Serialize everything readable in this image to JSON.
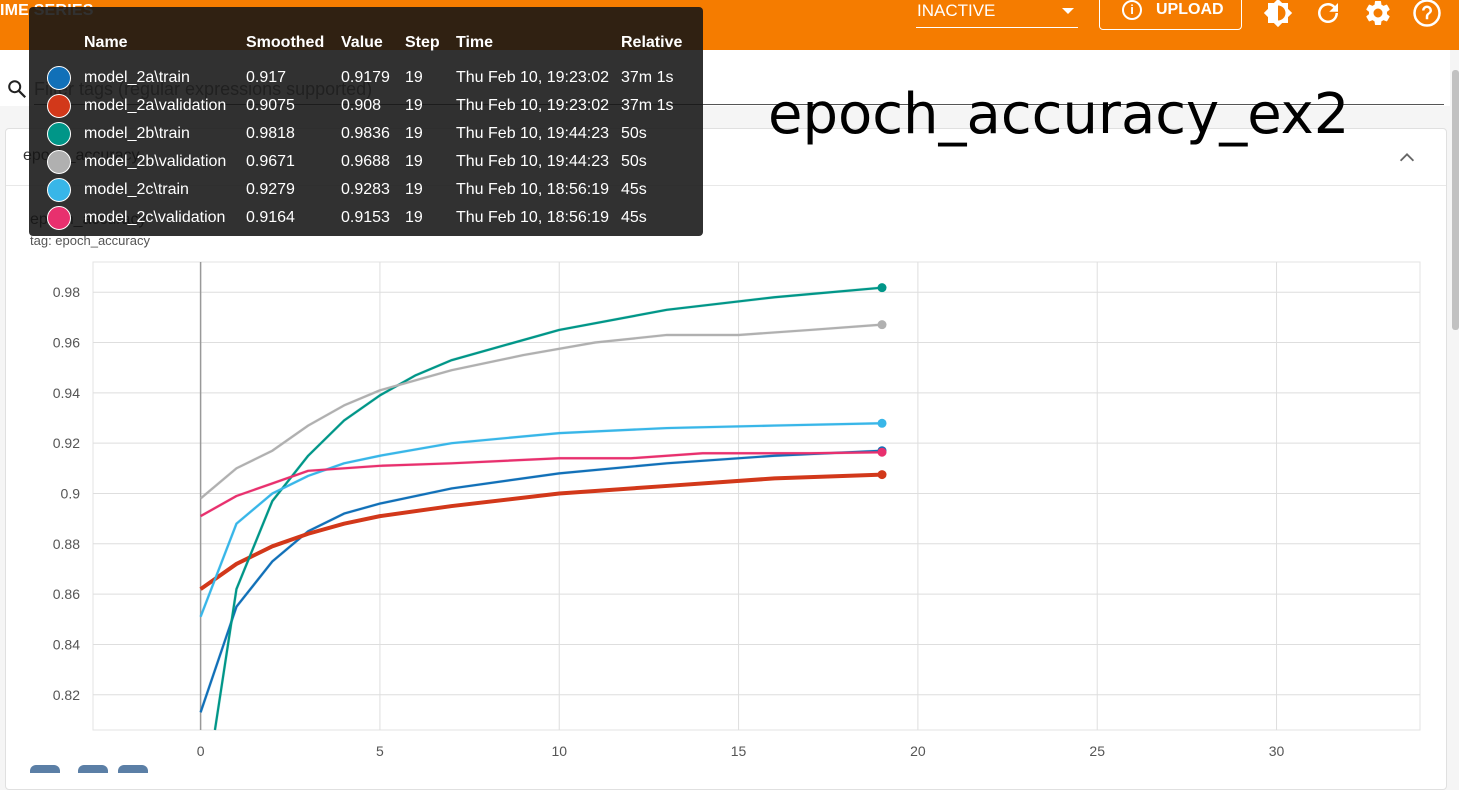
{
  "header": {
    "title": "IME SERIES",
    "status_value": "INACTIVE",
    "upload_label": "UPLOAD",
    "icons": [
      "brightness-icon",
      "refresh-icon",
      "settings-icon",
      "help-icon"
    ]
  },
  "filter": {
    "placeholder": "Filter tags (regular expressions supported)"
  },
  "card": {
    "group_name": "epoch_accuracy",
    "overlay_caption": "epoch_accuracy_ex2"
  },
  "chart_data": {
    "type": "line",
    "title": "epoch_accuracy",
    "subtitle": "tag: epoch_accuracy",
    "xlabel": "",
    "ylabel": "",
    "xlim": [
      -3,
      34
    ],
    "ylim": [
      0.806,
      0.992
    ],
    "x_ticks": [
      "0",
      "5",
      "10",
      "15",
      "20",
      "25",
      "30"
    ],
    "y_ticks": [
      "0.82",
      "0.84",
      "0.86",
      "0.88",
      "0.9",
      "0.92",
      "0.94",
      "0.96",
      "0.98"
    ],
    "grid": true,
    "series": [
      {
        "name": "model_2a\\train",
        "color": "#1170b8",
        "x": [
          0,
          1,
          2,
          3,
          4,
          5,
          7,
          10,
          13,
          16,
          19
        ],
        "y": [
          0.813,
          0.855,
          0.873,
          0.885,
          0.892,
          0.896,
          0.902,
          0.908,
          0.912,
          0.915,
          0.917
        ]
      },
      {
        "name": "model_2a\\validation",
        "color": "#d2381a",
        "x": [
          0,
          1,
          2,
          3,
          4,
          5,
          7,
          10,
          13,
          16,
          19
        ],
        "y": [
          0.862,
          0.872,
          0.879,
          0.884,
          0.888,
          0.891,
          0.895,
          0.9,
          0.903,
          0.906,
          0.9075
        ]
      },
      {
        "name": "model_2b\\train",
        "color": "#009688",
        "x": [
          0.4,
          1,
          2,
          3,
          4,
          5,
          6,
          7,
          8,
          10,
          13,
          16,
          19
        ],
        "y": [
          0.806,
          0.862,
          0.897,
          0.915,
          0.929,
          0.939,
          0.947,
          0.953,
          0.957,
          0.965,
          0.973,
          0.978,
          0.9818
        ]
      },
      {
        "name": "model_2b\\validation",
        "color": "#b0b0b0",
        "x": [
          0,
          1,
          2,
          3,
          4,
          5,
          7,
          9,
          11,
          13,
          15,
          17,
          19
        ],
        "y": [
          0.898,
          0.91,
          0.917,
          0.927,
          0.935,
          0.941,
          0.949,
          0.955,
          0.96,
          0.963,
          0.963,
          0.965,
          0.9671
        ]
      },
      {
        "name": "model_2c\\train",
        "color": "#38b6e8",
        "x": [
          0,
          1,
          2,
          3,
          4,
          5,
          7,
          10,
          13,
          16,
          19
        ],
        "y": [
          0.851,
          0.888,
          0.9,
          0.907,
          0.912,
          0.915,
          0.92,
          0.924,
          0.926,
          0.927,
          0.9279
        ]
      },
      {
        "name": "model_2c\\validation",
        "color": "#e8306e",
        "x": [
          0,
          1,
          2,
          3,
          5,
          7,
          10,
          12,
          14,
          17,
          19
        ],
        "y": [
          0.891,
          0.899,
          0.904,
          0.909,
          0.911,
          0.912,
          0.914,
          0.914,
          0.916,
          0.916,
          0.9164
        ]
      }
    ]
  },
  "tooltip": {
    "headers": {
      "name": "Name",
      "smoothed": "Smoothed",
      "value": "Value",
      "step": "Step",
      "time": "Time",
      "relative": "Relative"
    },
    "rows": [
      {
        "color": "#1170b8",
        "name": "model_2a\\train",
        "smoothed": "0.917",
        "value": "0.9179",
        "step": "19",
        "time": "Thu Feb 10, 19:23:02",
        "relative": "37m 1s"
      },
      {
        "color": "#d2381a",
        "name": "model_2a\\validation",
        "smoothed": "0.9075",
        "value": "0.908",
        "step": "19",
        "time": "Thu Feb 10, 19:23:02",
        "relative": "37m 1s"
      },
      {
        "color": "#009688",
        "name": "model_2b\\train",
        "smoothed": "0.9818",
        "value": "0.9836",
        "step": "19",
        "time": "Thu Feb 10, 19:44:23",
        "relative": "50s"
      },
      {
        "color": "#b0b0b0",
        "name": "model_2b\\validation",
        "smoothed": "0.9671",
        "value": "0.9688",
        "step": "19",
        "time": "Thu Feb 10, 19:44:23",
        "relative": "50s"
      },
      {
        "color": "#38b6e8",
        "name": "model_2c\\train",
        "smoothed": "0.9279",
        "value": "0.9283",
        "step": "19",
        "time": "Thu Feb 10, 18:56:19",
        "relative": "45s"
      },
      {
        "color": "#e8306e",
        "name": "model_2c\\validation",
        "smoothed": "0.9164",
        "value": "0.9153",
        "step": "19",
        "time": "Thu Feb 10, 18:56:19",
        "relative": "45s"
      }
    ]
  }
}
